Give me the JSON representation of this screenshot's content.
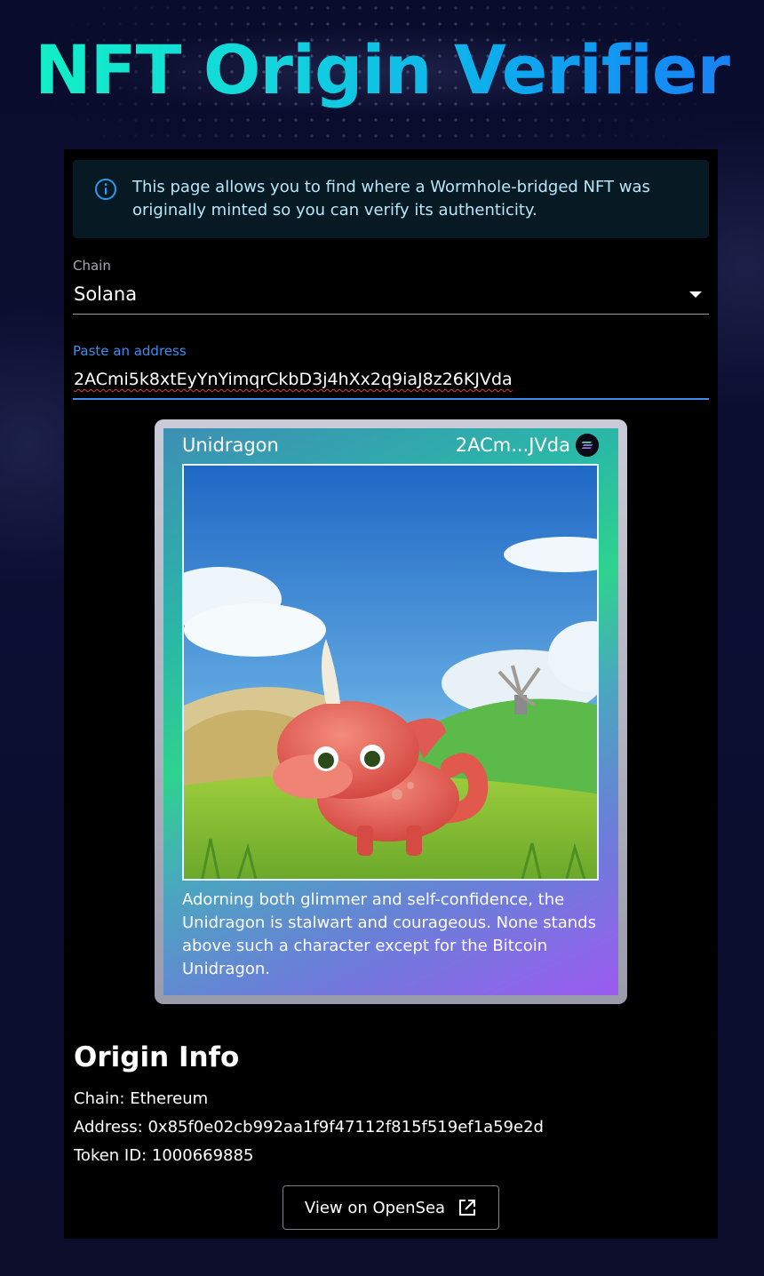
{
  "page": {
    "title": "NFT Origin Verifier"
  },
  "info_banner": {
    "icon": "info-icon",
    "text": "This page allows you to find where a Wormhole-bridged NFT was originally minted so you can verify its authenticity."
  },
  "chain_select": {
    "label": "Chain",
    "value": "Solana",
    "icon": "caret-down-icon"
  },
  "address_field": {
    "label": "Paste an address",
    "value": "2ACmi5k8xtEyYnYimqrCkbD3j4hXx2q9iaJ8z26KJVda"
  },
  "nft_card": {
    "name": "Unidragon",
    "short_address": "2ACm...JVda",
    "chain_icon": "solana-icon",
    "description": "Adorning both glimmer and self-confidence, the Unidragon is stalwart and courageous. None stands above such a character except for the Bitcoin Unidragon."
  },
  "origin_info": {
    "title": "Origin Info",
    "chain": "Chain: Ethereum",
    "address": "Address: 0x85f0e02cb992aa1f9f47112f815f519ef1a59e2d",
    "token_id": "Token ID: 1000669885"
  },
  "actions": {
    "opensea_label": "View on OpenSea",
    "opensea_icon": "external-link-icon"
  },
  "colors": {
    "accent": "#3b8df0",
    "title_gradient_start": "#12f2c4",
    "title_gradient_end": "#1a7cf5",
    "info_bg": "#071923",
    "info_text": "#b8e6fb"
  }
}
